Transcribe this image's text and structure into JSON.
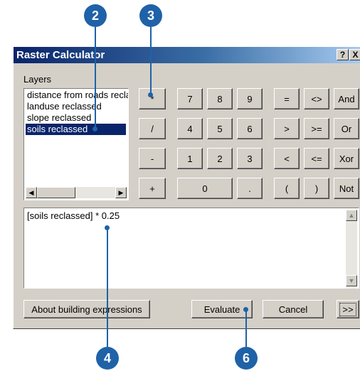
{
  "window": {
    "title": "Raster Calculator",
    "help_button": "?",
    "close_button": "X"
  },
  "layers": {
    "label": "Layers",
    "items": [
      {
        "label": "distance from roads recla",
        "selected": false
      },
      {
        "label": "landuse reclassed",
        "selected": false
      },
      {
        "label": "slope reclassed",
        "selected": false
      },
      {
        "label": "soils reclassed",
        "selected": true
      }
    ],
    "scroll_left": "◀",
    "scroll_right": "▶"
  },
  "keypad": {
    "operators": [
      "*",
      "/",
      "-",
      "+"
    ],
    "digits_row1": [
      "7",
      "8",
      "9"
    ],
    "digits_row2": [
      "4",
      "5",
      "6"
    ],
    "digits_row3": [
      "1",
      "2",
      "3"
    ],
    "zero": "0",
    "decimal": ".",
    "compare_col1": [
      "=",
      ">",
      "<",
      "("
    ],
    "compare_col2": [
      "<>",
      ">=",
      "<=",
      ")"
    ],
    "logical": [
      "And",
      "Or",
      "Xor",
      "Not"
    ]
  },
  "expression": {
    "value": "[soils reclassed] * 0.25",
    "scroll_up": "▲",
    "scroll_down": "▼"
  },
  "buttons": {
    "about": "About building expressions",
    "evaluate": "Evaluate",
    "cancel": "Cancel",
    "more": ">>"
  },
  "callouts": [
    "2",
    "3",
    "4",
    "6"
  ],
  "colors": {
    "callout": "#1f62a8",
    "title_bar_start": "#0a246a",
    "title_bar_end": "#a6caf0",
    "dialog_face": "#d4d0c8",
    "selection": "#0a246a"
  }
}
